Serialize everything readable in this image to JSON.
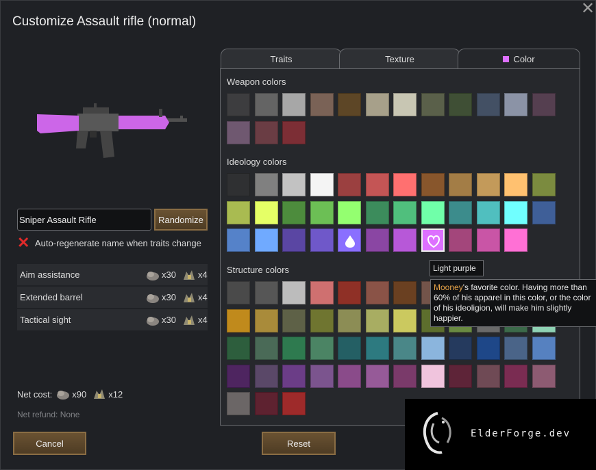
{
  "title": "Customize Assault rifle (normal)",
  "weapon": {
    "name_value": "Sniper Assault Rifle"
  },
  "buttons": {
    "randomize": "Randomize",
    "cancel": "Cancel",
    "reset": "Reset"
  },
  "auto_regen_label": "Auto-regenerate name when traits change",
  "traits": [
    {
      "name": "Aim assistance",
      "steel": "x30",
      "components": "x4"
    },
    {
      "name": "Extended barrel",
      "steel": "x30",
      "components": "x4"
    },
    {
      "name": "Tactical sight",
      "steel": "x30",
      "components": "x4"
    }
  ],
  "net_cost": {
    "label": "Net cost:",
    "steel": "x90",
    "components": "x12"
  },
  "net_refund": "Net refund: None",
  "tabs": [
    {
      "label": "Traits",
      "icon": ""
    },
    {
      "label": "Texture",
      "icon": ""
    },
    {
      "label": "Color",
      "icon": "color-square-icon"
    }
  ],
  "sections": {
    "weapon": "Weapon colors",
    "ideology": "Ideology colors",
    "structure": "Structure colors"
  },
  "weapon_colors": [
    "#3d3d3f",
    "#646464",
    "#a7a7a7",
    "#7a6256",
    "#5d4626",
    "#a7a08a",
    "#c8c6b3",
    "#5a604a",
    "#3f4f35",
    "#435064",
    "#8b93a6",
    "#553f50",
    "#6f5870",
    "#6a3d44",
    "#7c2e35"
  ],
  "ideology_colors": [
    "#2f3032",
    "#808080",
    "#c2c2c2",
    "#f4f4f4",
    "#9b4040",
    "#c45555",
    "#ff7070",
    "#88562c",
    "#a37d46",
    "#c39a5a",
    "#ffc170",
    "#7b8b3f",
    "#a9bb51",
    "#e5ff66",
    "#4d8c3d",
    "#6cbf55",
    "#94ff70",
    "#3c8c5c",
    "#50bf7d",
    "#70ffa9",
    "#3c8c8c",
    "#50bfbf",
    "#70ffff",
    "#3f5f98",
    "#5582c9",
    "#70aaff",
    "#5a46a3",
    "#6f58c9",
    "#8a6fff",
    "#8a46a3",
    "#b758d8",
    "#dd70ff",
    "#a3467b",
    "#c955a6",
    "#ff70d5"
  ],
  "ideology_special": {
    "drop_icon_index": 28,
    "selected_index": 31
  },
  "structure_colors": [
    "#4a4a4a",
    "#565656",
    "#bcbcbc",
    "#cf7070",
    "#8f3026",
    "#8a5347",
    "#6a4021",
    "#73544a",
    "#3a3a3a",
    "#3a3a3a",
    "#3a3a3a",
    "#3a3a3a",
    "#c08a1c",
    "#a98b3a",
    "#5e6147",
    "#6f7530",
    "#8c8d55",
    "#a8ad62",
    "#cbc95f",
    "#5d6e2d",
    "#6a8a42",
    "#6a6a6a",
    "#3c6a4a",
    "#8fd2b4",
    "#2d5e3d",
    "#4a6a57",
    "#2e7a4f",
    "#4b8464",
    "#245f64",
    "#2d7a80",
    "#4a8788",
    "#8bb5dd",
    "#253a5e",
    "#1e4788",
    "#4a6488",
    "#5681c0",
    "#4e2560",
    "#5a4868",
    "#6b3d87",
    "#7b548e",
    "#8a4b8a",
    "#965a98",
    "#7a3a6a",
    "#f0c4dd",
    "#5e2438",
    "#6f4a55",
    "#7a2c52",
    "#8d5b72",
    "#6b6666",
    "#5e2230",
    "#9e2a2a"
  ],
  "tooltip": {
    "name": "Light purple",
    "owner": "Mooney",
    "desc": "'s favorite color. Having more than 60% of his apparel in this color, or the color of his ideoligion, will make him slightly happier."
  },
  "watermark": "ElderForge.dev"
}
